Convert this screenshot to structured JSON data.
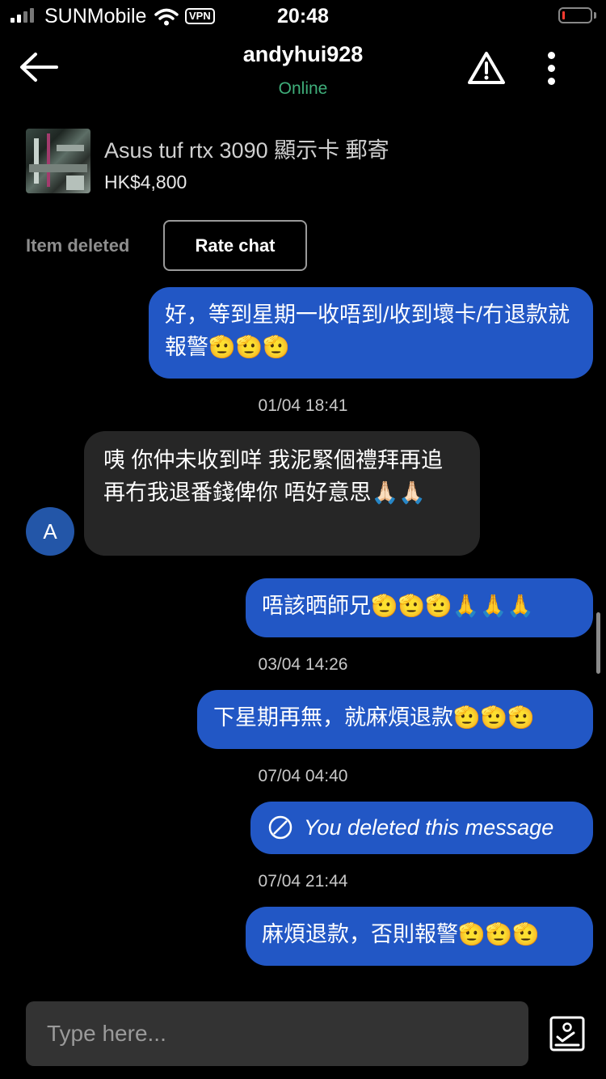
{
  "status_bar": {
    "carrier": "SUNMobile",
    "vpn": "VPN",
    "time": "20:48",
    "battery_color": "#ff3b30"
  },
  "header": {
    "back_icon": "back-arrow-icon",
    "username": "andyhui928",
    "status": "Online",
    "report_icon": "warning-triangle-icon",
    "menu_icon": "more-vertical-icon"
  },
  "item": {
    "title": "Asus tuf rtx 3090 顯示卡 郵寄",
    "price": "HK$4,800",
    "state": "Item deleted",
    "rate_button": "Rate chat"
  },
  "messages": [
    {
      "from": "me",
      "text": "好，等到星期一收唔到/收到壞卡/冇退款就報警🫡🫡🫡"
    },
    {
      "timestamp": "01/04 18:41"
    },
    {
      "from": "them",
      "avatar": "A",
      "text": "咦 你仲未收到咩 我泥緊個禮拜再追 再冇我退番錢俾你 唔好意思🙏🏻🙏🏻"
    },
    {
      "from": "me",
      "text": "唔該晒師兄🫡🫡🫡🙏🙏🙏"
    },
    {
      "timestamp": "03/04 14:26"
    },
    {
      "from": "me",
      "text": "下星期再無，就麻煩退款🫡🫡🫡"
    },
    {
      "timestamp": "07/04 04:40"
    },
    {
      "from": "me",
      "deleted": true,
      "text": "You deleted this message"
    },
    {
      "timestamp": "07/04 21:44"
    },
    {
      "from": "me",
      "text": "麻煩退款，否則報警🫡🫡🫡"
    }
  ],
  "composer": {
    "placeholder": "Type here...",
    "image_icon": "image-upload-icon"
  },
  "colors": {
    "bubble_me": "#2257c5",
    "bubble_them": "#262626",
    "online": "#3fae7a",
    "avatar": "#2356a8"
  }
}
